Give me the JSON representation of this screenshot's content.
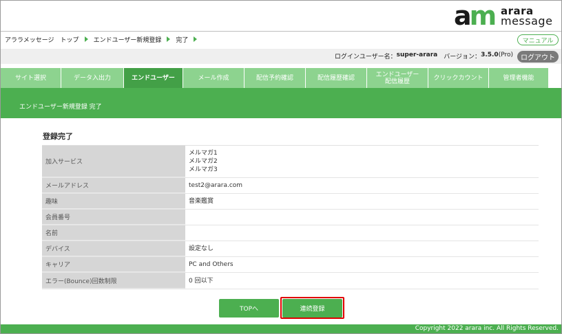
{
  "logo": {
    "mark_a": "a",
    "mark_m": "m",
    "text_top": "arara",
    "text_bottom": "message"
  },
  "breadcrumb": [
    "アララメッセージ　トップ",
    "エンドユーザー新規登録",
    "完了"
  ],
  "manual_label": "マニュアル",
  "login": {
    "prefix": "ログインユーザー名：",
    "user": "super-arara",
    "version_prefix": "　バージョン：",
    "version": "3.5.0",
    "edition": " (Pro)"
  },
  "logout_label": "ログアウト",
  "tabs": [
    {
      "label": "サイト選択"
    },
    {
      "label": "データ入出力"
    },
    {
      "label": "エンドユーザー"
    },
    {
      "label": "メール作成"
    },
    {
      "label": "配信予約確認"
    },
    {
      "label": "配信履歴確認"
    },
    {
      "label": "エンドユーザー\n配信履歴"
    },
    {
      "label": "クリックカウント"
    },
    {
      "label": "管理者機能"
    }
  ],
  "active_tab": "エンドユーザー",
  "band_title": "エンドユーザー新規登録 完了",
  "section_title": "登録完了",
  "rows": [
    {
      "label": "加入サービス",
      "values": [
        "メルマガ1",
        "メルマガ2",
        "メルマガ3"
      ]
    },
    {
      "label": "メールアドレス",
      "values": [
        "test2@arara.com"
      ]
    },
    {
      "label": "趣味",
      "values": [
        "音楽鑑賞"
      ]
    },
    {
      "label": "会員番号",
      "values": [
        ""
      ]
    },
    {
      "label": "名前",
      "values": [
        ""
      ]
    },
    {
      "label": "デバイス",
      "values": [
        "設定なし"
      ]
    },
    {
      "label": "キャリア",
      "values": [
        "PC and Others"
      ]
    },
    {
      "label": "エラー(Bounce)回数制限",
      "values": [
        "0 回以下"
      ]
    }
  ],
  "buttons": {
    "top": "TOPへ",
    "continue": "連続登録"
  },
  "colors": {
    "accent": "#4caf50",
    "tab_light": "#8dd38f",
    "highlight": "#e00000"
  },
  "footer": {
    "copyright": "Copyright 2022 arara inc. All Rights Reserved."
  }
}
